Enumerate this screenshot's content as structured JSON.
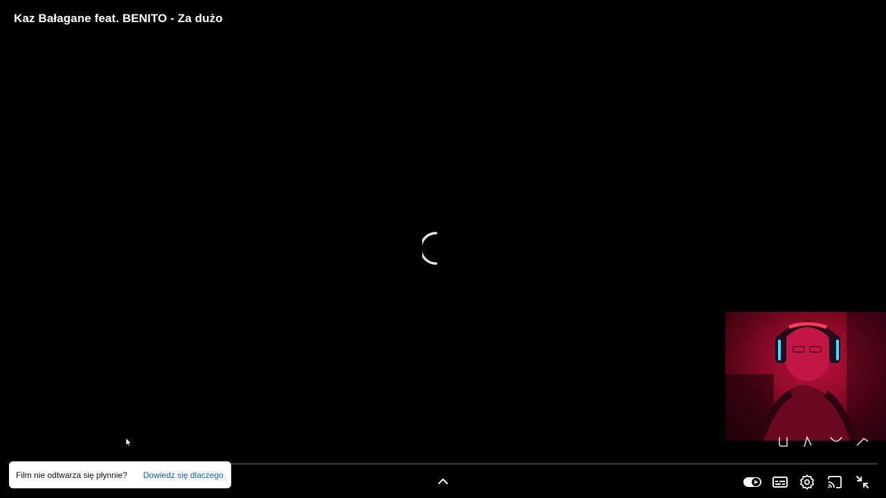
{
  "video": {
    "title": "Kaz Bałagane feat. BENITO - Za dużo"
  },
  "player": {
    "state": "loading",
    "autoplay_toggle": "on",
    "icons": {
      "spinner": "loading-spinner-icon",
      "chevron": "chevron-up-icon",
      "autoplay": "autoplay-toggle-icon",
      "subtitles": "subtitles-icon",
      "settings": "settings-gear-icon",
      "cast": "cast-icon",
      "exit_fullscreen": "exit-fullscreen-icon"
    }
  },
  "toast": {
    "message": "Film nie odtwarza się płynnie?",
    "link": "Dowiedz się dlaczego"
  },
  "colors": {
    "background": "#000000",
    "toast_bg": "#ffffff",
    "link": "#065fd4",
    "webcam_tint": "#c8103f"
  }
}
